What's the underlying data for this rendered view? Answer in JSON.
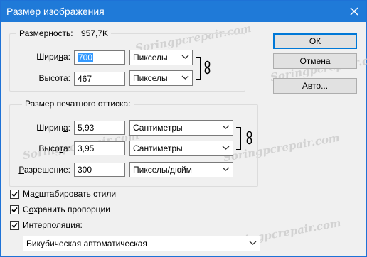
{
  "window": {
    "title": "Размер изображения"
  },
  "dimensions": {
    "label": "Размерность:",
    "value": "957,7K",
    "width": {
      "label_pre": "Шири",
      "label_ul": "н",
      "label_post": "а:",
      "value": "700",
      "unit": "Пикселы"
    },
    "height": {
      "label_pre": "В",
      "label_ul": "ы",
      "label_post": "сота:",
      "value": "467",
      "unit": "Пикселы"
    }
  },
  "print_size": {
    "title": "Размер печатного оттиска:",
    "width": {
      "label_pre": "Ширин",
      "label_ul": "а",
      "label_post": ":",
      "value": "5,93",
      "unit": "Сантиметры"
    },
    "height": {
      "label_pre": "Высо",
      "label_ul": "т",
      "label_post": "а:",
      "value": "3,95",
      "unit": "Сантиметры"
    },
    "resolution": {
      "label_pre": "",
      "label_ul": "Р",
      "label_post": "азрешение:",
      "value": "300",
      "unit": "Пикселы/дюйм"
    }
  },
  "buttons": {
    "ok": "ОК",
    "cancel": "Отмена",
    "auto": "Авто..."
  },
  "options": {
    "scale_styles": {
      "pre": "Ма",
      "ul": "с",
      "post": "штабировать стили",
      "checked": true
    },
    "constrain": {
      "pre": "С",
      "ul": "о",
      "post": "хранить пропорции",
      "checked": true
    },
    "resample": {
      "pre": "",
      "ul": "И",
      "post": "нтерполяция:",
      "checked": true
    },
    "method": "Бикубическая автоматическая"
  },
  "watermark": "Soringpcrepair.com",
  "icons": {
    "close": "close-icon",
    "link": "chain-link-icon",
    "dropdown": "chevron-down-icon",
    "check": "checkmark-icon"
  },
  "colors": {
    "titlebar": "#1f7ad8",
    "dialog_bg": "#f0f0f0",
    "selection": "#3399ff",
    "default_button_border": "#0078d7"
  }
}
